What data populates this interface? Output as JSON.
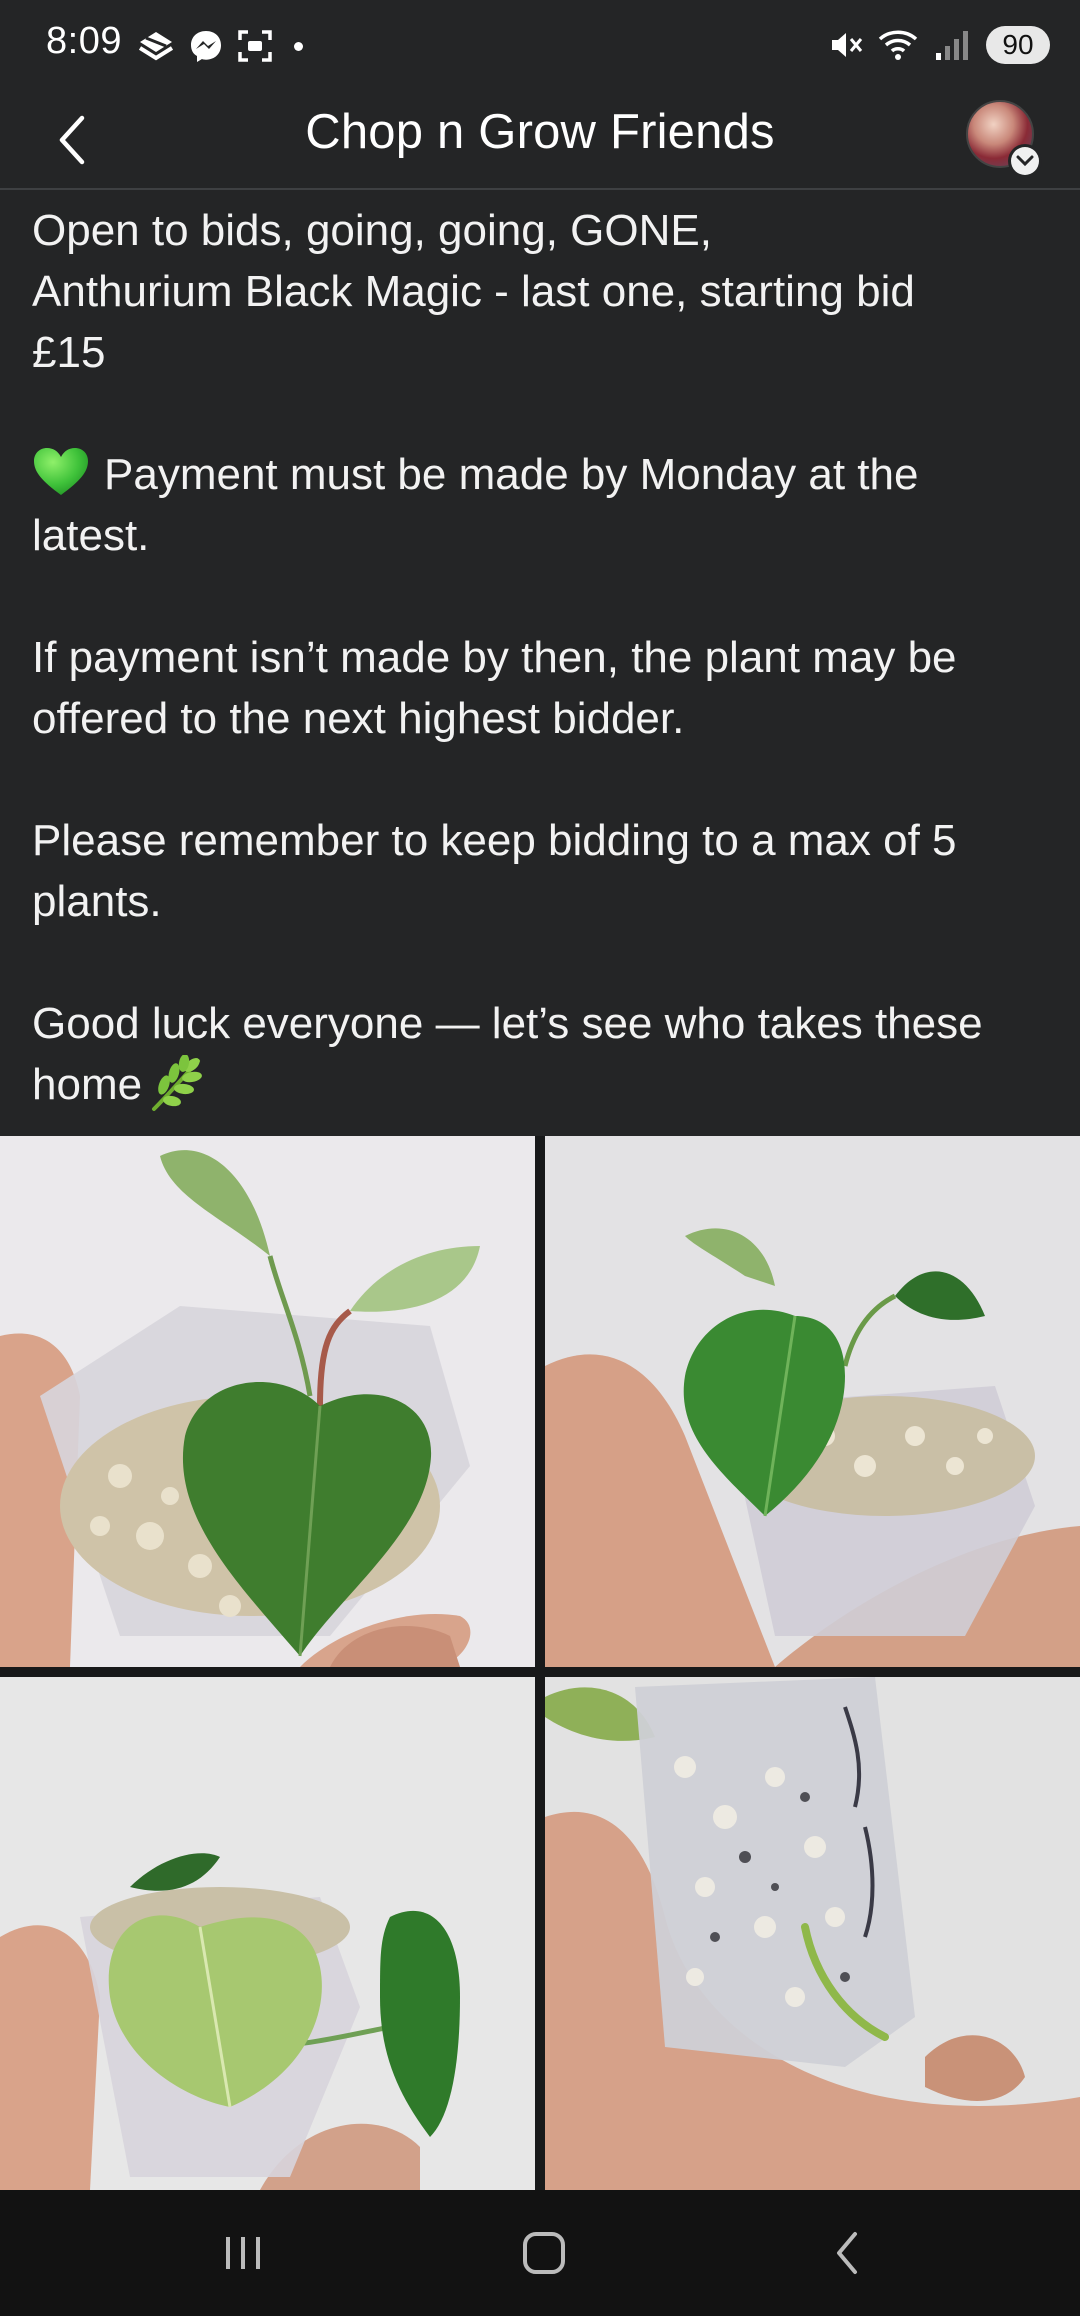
{
  "status_bar": {
    "time": "8:09",
    "battery": "90",
    "left_icons": [
      "app-notification-icon",
      "messenger-icon",
      "screenshot-icon",
      "dot-indicator"
    ],
    "right_icons": [
      "mute-icon",
      "wifi-icon",
      "signal-icon"
    ]
  },
  "header": {
    "title": "Chop n Grow Friends",
    "back_icon": "chevron-left-icon",
    "avatar_badge_icon": "chevron-down-icon"
  },
  "post": {
    "paragraphs": [
      {
        "line1": "Open to bids, going, going, GONE,",
        "line2": "Anthurium Black Magic - last one, starting bid",
        "line3": "£15"
      },
      {
        "emoji": "green-heart",
        "line1": "Payment must be made by Monday at the",
        "line2": "latest."
      },
      {
        "line1": "If payment isn’t made by then, the plant may be",
        "line2": "offered to the next highest bidder."
      },
      {
        "line1": "Please remember to keep bidding to a max of 5",
        "line2": "plants."
      },
      {
        "line1": "Good luck everyone — let’s see who takes these",
        "line2": "home",
        "emoji": "herb"
      }
    ]
  },
  "photos": [
    {
      "name": "plant-photo-1",
      "pot_label": ""
    },
    {
      "name": "plant-photo-2",
      "pot_label": ""
    },
    {
      "name": "plant-photo-3",
      "pot_label": ""
    },
    {
      "name": "plant-photo-4",
      "pot_label": ""
    }
  ],
  "colors": {
    "background": "#242526",
    "text": "#f2f2f2",
    "divider": "#3e4042",
    "nav_bar": "#121212",
    "leaf_green": "#3f7d2e"
  },
  "nav_bar": {
    "buttons": [
      "recent-apps-icon",
      "home-icon",
      "back-icon"
    ]
  }
}
